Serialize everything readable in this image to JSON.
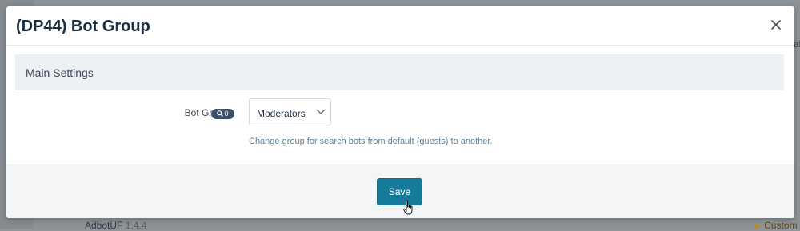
{
  "background": {
    "right_fragment": "al",
    "footer_left_name": "AdbotUF",
    "footer_left_version": "1.4.4",
    "footer_right_text": "Custom"
  },
  "modal": {
    "title": "(DP44) Bot Group",
    "close_icon": "close-icon",
    "section_title": "Main Settings",
    "field": {
      "label": "Bot Group",
      "required_marker": "*",
      "search_count": "0",
      "select_value": "Moderators",
      "hint": "Change group for search bots from default (guests) to another."
    },
    "save_label": "Save"
  },
  "colors": {
    "primary_button": "#167b9b",
    "title": "#1b2d40",
    "required": "#d0312d",
    "badge": "#3b4f66",
    "hint": "#5a8299"
  }
}
